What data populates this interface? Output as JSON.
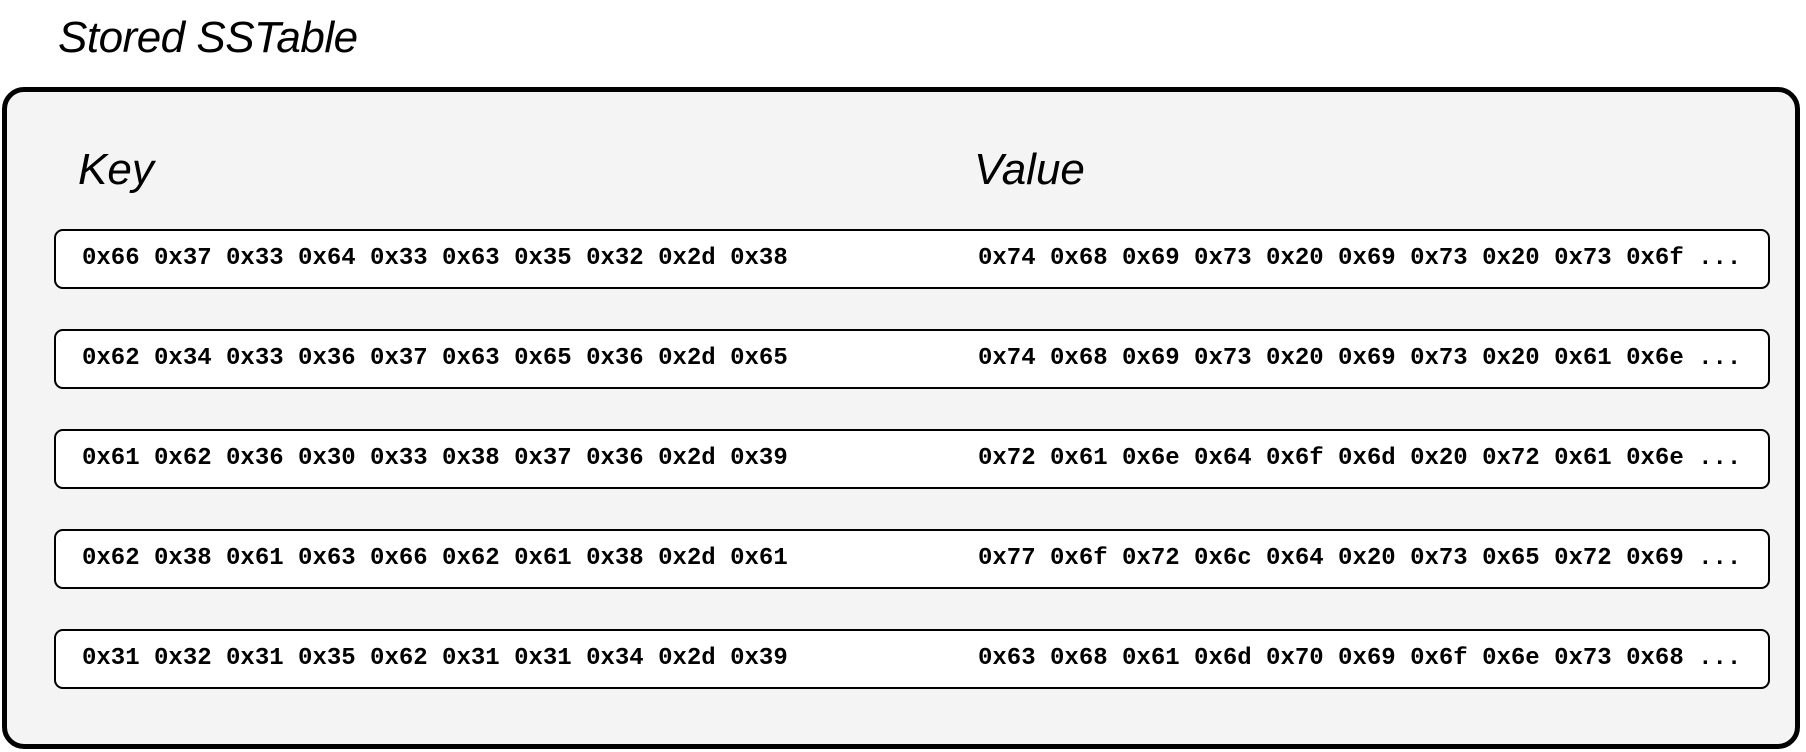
{
  "title": "Stored SSTable",
  "columns": {
    "key": "Key",
    "value": "Value"
  },
  "rows": [
    {
      "key": "0x66 0x37 0x33 0x64 0x33 0x63 0x35 0x32 0x2d 0x38",
      "value": "0x74 0x68 0x69 0x73 0x20 0x69 0x73 0x20 0x73 0x6f ..."
    },
    {
      "key": "0x62 0x34 0x33 0x36 0x37 0x63 0x65 0x36 0x2d 0x65",
      "value": "0x74 0x68 0x69 0x73 0x20 0x69 0x73 0x20 0x61 0x6e ..."
    },
    {
      "key": "0x61 0x62 0x36 0x30 0x33 0x38 0x37 0x36 0x2d 0x39",
      "value": "0x72 0x61 0x6e 0x64 0x6f 0x6d 0x20 0x72 0x61 0x6e ..."
    },
    {
      "key": "0x62 0x38 0x61 0x63 0x66 0x62 0x61 0x38 0x2d 0x61",
      "value": "0x77 0x6f 0x72 0x6c 0x64 0x20 0x73 0x65 0x72 0x69 ..."
    },
    {
      "key": "0x31 0x32 0x31 0x35 0x62 0x31 0x31 0x34 0x2d 0x39",
      "value": "0x63 0x68 0x61 0x6d 0x70 0x69 0x6f 0x6e 0x73 0x68 ..."
    }
  ]
}
